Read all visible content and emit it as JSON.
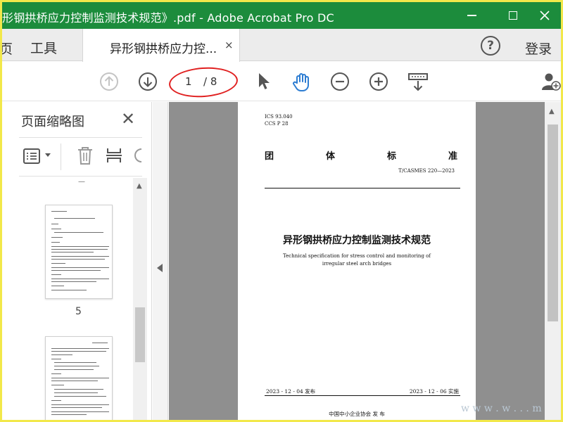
{
  "window": {
    "title": "形钢拱桥应力控制监测技术规范》.pdf - Adobe Acrobat Pro DC"
  },
  "tabs": {
    "prev_partial": "页",
    "tools": "工具",
    "document": "异形钢拱桥应力控...",
    "close_symbol": "×",
    "help_symbol": "?",
    "login": "登录"
  },
  "toolbar": {
    "current_page": "1",
    "total_pages": "/ 8",
    "icons": [
      "prev-page-icon",
      "next-page-icon",
      "select-arrow-icon",
      "hand-tool-icon",
      "zoom-out-icon",
      "zoom-in-icon",
      "page-scroll-icon",
      "share-user-icon"
    ],
    "highlight_color": "#e02020",
    "accent_color": "#2d7dd2"
  },
  "left_panel": {
    "title": "页面缩略图",
    "close_symbol": "✕",
    "thumbnails": [
      {
        "page_label": "5"
      },
      {
        "page_label": ""
      }
    ]
  },
  "page": {
    "ics": "ICS  93.040",
    "ccs": "CCS  P 28",
    "standard_chars": [
      "团",
      "体",
      "标",
      "准"
    ],
    "code": "T/CASMES 220—2023",
    "title_cn": "异形钢拱桥应力控制监测技术规范",
    "title_en": "Technical specification for stress control and monitoring of irregular steel arch bridges",
    "issue_date": "2023 - 12 - 04 发布",
    "impl_date": "2023 - 12 - 06 实施",
    "publisher": "中国中小企业协会      发  布"
  },
  "watermark": "w w w . w . . . m",
  "colors": {
    "titlebar": "#1c8c3c",
    "window_border": "#f2e84a",
    "doc_background": "#8f8f8f"
  }
}
